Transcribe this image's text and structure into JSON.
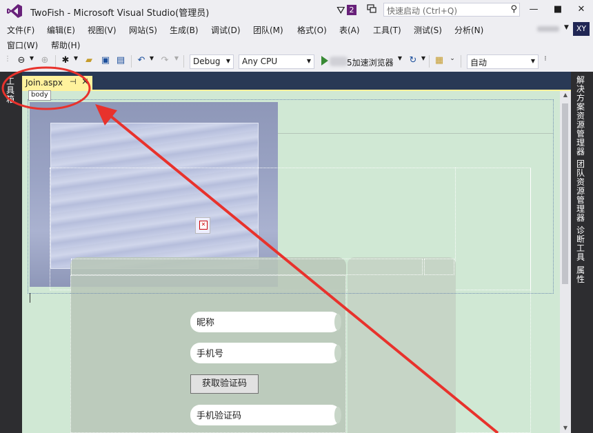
{
  "window": {
    "title": "TwoFish - Microsoft Visual Studio(管理员)"
  },
  "notifications": {
    "count": "2"
  },
  "quick_launch": {
    "placeholder": "快速启动 (Ctrl+Q)"
  },
  "menu": {
    "row1": [
      "文件(F)",
      "编辑(E)",
      "视图(V)",
      "网站(S)",
      "生成(B)",
      "调试(D)",
      "团队(M)",
      "格式(O)",
      "表(A)",
      "工具(T)",
      "测试(S)",
      "分析(N)"
    ],
    "row2": [
      "窗口(W)",
      "帮助(H)"
    ]
  },
  "user": {
    "initials": "XY"
  },
  "toolbar": {
    "configuration": "Debug",
    "platform": "Any CPU",
    "browser_label": "5加速浏览器",
    "zoom_combo": "自动"
  },
  "left_panel": {
    "toolbox": "工具箱"
  },
  "right_panels": [
    "解决方案资源管理器",
    "团队资源管理器",
    "诊断工具",
    "属性"
  ],
  "editor": {
    "tab_name": "Join.aspx",
    "tag_label": "body"
  },
  "form": {
    "nickname": "昵称",
    "phone": "手机号",
    "get_code_button": "获取验证码",
    "phone_code": "手机验证码"
  },
  "colors": {
    "vs_purple": "#68217a",
    "tab_yellow": "#fff29d",
    "dark_chrome": "#2d2d30",
    "design_green": "#d0e8d4",
    "annotation_red": "#e8322c"
  }
}
